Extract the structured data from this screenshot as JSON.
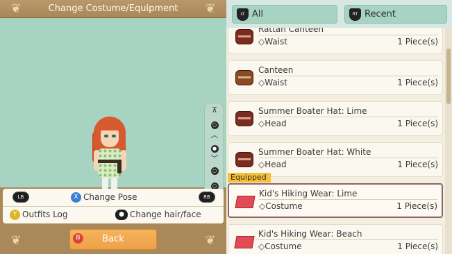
{
  "header": {
    "title": "Change Costume/Equipment"
  },
  "slider": {
    "top": "⊼",
    "bottom": "⊻"
  },
  "controls": {
    "lb": "LB",
    "rb": "RB",
    "change_pose_button": "X",
    "change_pose": "Change Pose",
    "outfits_log_button": "Y",
    "outfits_log": "Outfits Log",
    "change_hair_button": "●",
    "change_hair": "Change hair/face"
  },
  "back": {
    "button_glyph": "B",
    "label": "Back"
  },
  "filters": [
    {
      "tag": "LT",
      "label": "All"
    },
    {
      "tag": "RT",
      "label": "Recent"
    }
  ],
  "equipped_label": "Equipped",
  "items": [
    {
      "name": "Rattan Canteen",
      "slot": "◇Waist",
      "qty": "1 Piece(s)",
      "icon": "barrel-icon"
    },
    {
      "name": "Canteen",
      "slot": "◇Waist",
      "qty": "1 Piece(s)",
      "icon": "barrel-icon"
    },
    {
      "name": "Summer Boater Hat: Lime",
      "slot": "◇Head",
      "qty": "1 Piece(s)",
      "icon": "barrel-icon"
    },
    {
      "name": "Summer Boater Hat: White",
      "slot": "◇Head",
      "qty": "1 Piece(s)",
      "icon": "barrel-icon"
    },
    {
      "name": "Kid's Hiking Wear: Lime",
      "slot": "◇Costume",
      "qty": "1 Piece(s)",
      "icon": "clothing-icon"
    },
    {
      "name": "Kid's Hiking Wear: Beach",
      "slot": "◇Costume",
      "qty": "1 Piece(s)",
      "icon": "clothing-icon"
    }
  ],
  "colors": {
    "accent": "#a7d3c2",
    "back_button": "#f5b45a",
    "equipped": "#f3c23a"
  }
}
